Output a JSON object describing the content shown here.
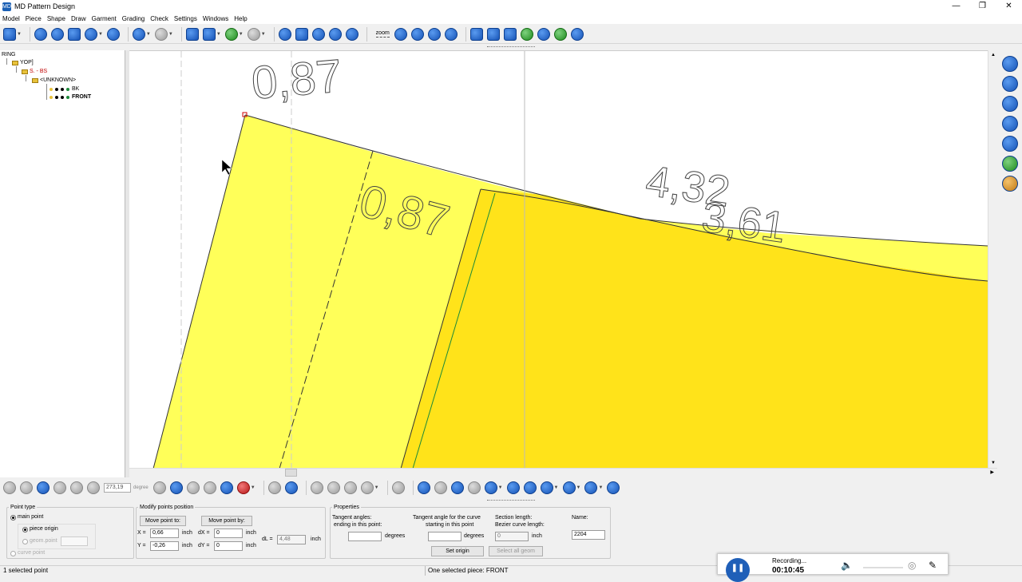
{
  "window": {
    "title": "MD Pattern Design",
    "app_icon": "MD",
    "controls": {
      "minimize": "—",
      "restore": "❐",
      "close": "✕"
    }
  },
  "menu": {
    "items": [
      "Model",
      "Piece",
      "Shape",
      "Draw",
      "Garment",
      "Grading",
      "Check",
      "Settings",
      "Windows",
      "Help"
    ]
  },
  "toolbar": {
    "zoom_label": "zoom"
  },
  "tree": {
    "root": "RING",
    "n1": "YOP]",
    "n2": "S. - BS",
    "n3": "<UNKNOWN>",
    "n4": "BK",
    "n5": "FRONT"
  },
  "canvas": {
    "labels": {
      "top_measure": "0,87",
      "mid_measure": "0,87",
      "right_a": "4,32",
      "right_b": "3,61"
    },
    "colors": {
      "piece_light": "#ffff59",
      "piece_dark": "#ffe31a",
      "outline": "#333333",
      "seam": "#1c8a3a"
    }
  },
  "toolbar2": {
    "coord_value": "273,19",
    "coord_unit": "degree"
  },
  "props": {
    "point_type": {
      "legend": "Point type",
      "main_point": "main point",
      "piece_origin": "piece origin",
      "geom_point": "geom.point",
      "curve_point": "curve point"
    },
    "modify": {
      "legend": "Modify points position",
      "move_to": "Move point to:",
      "move_by": "Move point by:",
      "x_label": "X =",
      "x_value": "0,66",
      "y_label": "Y =",
      "y_value": "-0,26",
      "unit": "inch",
      "dx_label": "dX =",
      "dx_value": "0",
      "dy_label": "dY =",
      "dy_value": "0",
      "dl_label": "dL =",
      "dl_value": "4,48"
    },
    "properties": {
      "legend": "Properties",
      "tan_end_1": "Tangent angles:",
      "tan_end_2": "ending in this point:",
      "tan_start_1": "Tangent angle for the curve",
      "tan_start_2": "starting in this point",
      "degrees": "degrees",
      "section_1": "Section length:",
      "section_2": "Bezier curve length:",
      "section_value": "0",
      "unit": "inch",
      "name_label": "Name:",
      "name_value": "2204",
      "set_origin": "Set origin",
      "select_all_geom": "Select all geom"
    }
  },
  "status": {
    "left": "1 selected point",
    "center": "One selected piece: FRONT"
  },
  "recorder": {
    "state": "Recording...",
    "time": "00:10:45"
  }
}
